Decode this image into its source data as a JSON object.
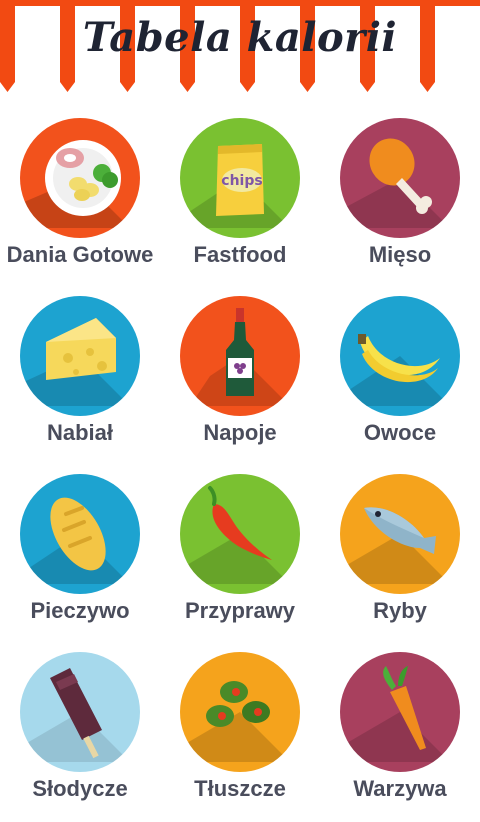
{
  "header": {
    "title": "Tabela kalorii",
    "colors": {
      "stripe_red": "#f24a12",
      "stripe_white": "#ffffff",
      "title_ink": "#1f2433"
    }
  },
  "categories": [
    {
      "label": "Dania Gotowe",
      "icon": "plate-icon",
      "circle_color": "#f2521c"
    },
    {
      "label": "Fastfood",
      "icon": "chips-icon",
      "circle_color": "#7ac131"
    },
    {
      "label": "Mięso",
      "icon": "drumstick-icon",
      "circle_color": "#a8405e"
    },
    {
      "label": "Nabiał",
      "icon": "cheese-icon",
      "circle_color": "#1da3d0"
    },
    {
      "label": "Napoje",
      "icon": "wine-bottle-icon",
      "circle_color": "#f2521c"
    },
    {
      "label": "Owoce",
      "icon": "banana-icon",
      "circle_color": "#1da3d0"
    },
    {
      "label": "Pieczywo",
      "icon": "bread-icon",
      "circle_color": "#1da3d0"
    },
    {
      "label": "Przyprawy",
      "icon": "chili-pepper-icon",
      "circle_color": "#7ac131"
    },
    {
      "label": "Ryby",
      "icon": "fish-icon",
      "circle_color": "#f5a31c"
    },
    {
      "label": "Słodycze",
      "icon": "ice-pop-icon",
      "circle_color": "#a6d9ec"
    },
    {
      "label": "Tłuszcze",
      "icon": "olives-icon",
      "circle_color": "#f5a31c"
    },
    {
      "label": "Warzywa",
      "icon": "carrot-icon",
      "circle_color": "#a8405e"
    }
  ]
}
